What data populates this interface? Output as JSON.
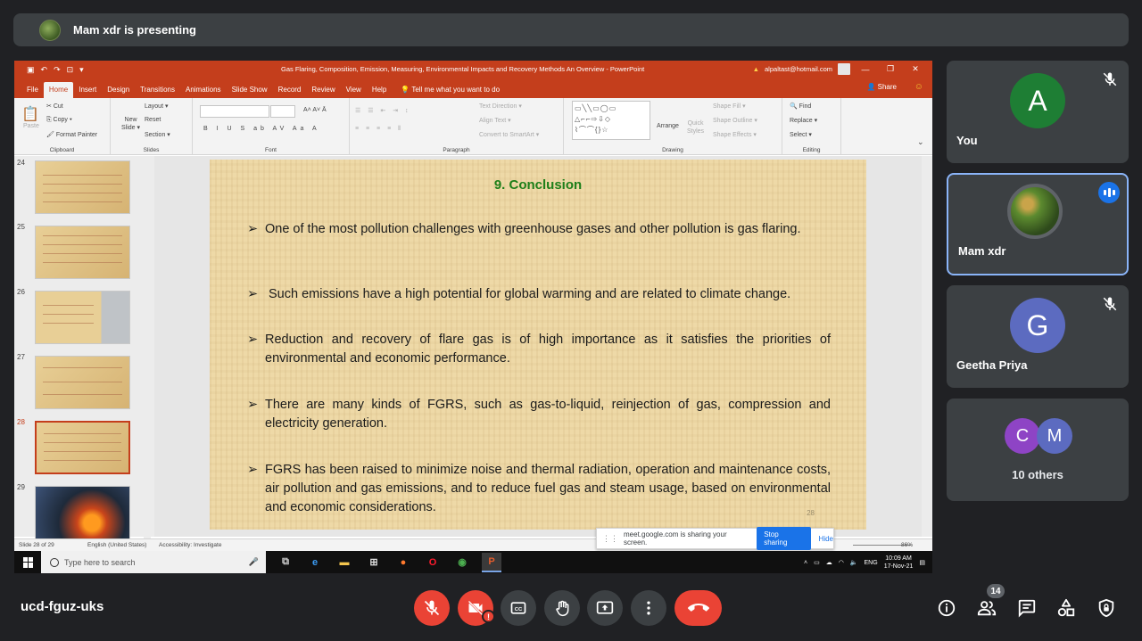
{
  "presenting_bar": {
    "text": "Mam xdr is presenting"
  },
  "ppt": {
    "window_title": "Gas Flaring, Composition, Emission, Measuring, Environmental Impacts and Recovery Methods An Overview  -  PowerPoint",
    "warning_icon": "warning-icon",
    "user_email": "alpaltast@hotmail.com",
    "tabs": [
      "File",
      "Home",
      "Insert",
      "Design",
      "Transitions",
      "Animations",
      "Slide Show",
      "Record",
      "Review",
      "View",
      "Help"
    ],
    "active_tab": "Home",
    "tell_me": "Tell me what you want to do",
    "share_label": "Share",
    "ribbon": {
      "clipboard": {
        "paste": "Paste",
        "cut": "Cut",
        "copy": "Copy",
        "format_painter": "Format Painter",
        "label": "Clipboard"
      },
      "slides": {
        "new_slide_line1": "New",
        "new_slide_line2": "Slide",
        "layout": "Layout",
        "reset": "Reset",
        "section": "Section",
        "label": "Slides"
      },
      "font": {
        "label": "Font"
      },
      "paragraph": {
        "text_direction": "Text Direction",
        "align_text": "Align Text",
        "convert_smartart": "Convert to SmartArt",
        "label": "Paragraph"
      },
      "drawing": {
        "arrange": "Arrange",
        "quick_styles_line1": "Quick",
        "quick_styles_line2": "Styles",
        "shape_fill": "Shape Fill",
        "shape_outline": "Shape Outline",
        "shape_effects": "Shape Effects",
        "label": "Drawing"
      },
      "editing": {
        "find": "Find",
        "replace": "Replace",
        "select": "Select",
        "label": "Editing"
      }
    },
    "thumbnails": [
      {
        "num": "24",
        "selected": false
      },
      {
        "num": "25",
        "selected": false
      },
      {
        "num": "26",
        "selected": false
      },
      {
        "num": "27",
        "selected": false
      },
      {
        "num": "28",
        "selected": true
      },
      {
        "num": "29",
        "selected": false
      }
    ],
    "slide": {
      "title": "9.   Conclusion",
      "bullets": [
        "One of the most pollution challenges with greenhouse gases and other pollution is gas flaring.",
        "Such emissions have a high potential for global warming and are related to climate change.",
        "Reduction and recovery of flare gas is of high importance as it satisfies the priorities of environmental and economic performance.",
        "There are many kinds of FGRS, such as gas-to-liquid, reinjection of gas, compression and electricity generation.",
        "FGRS has been raised to minimize noise and thermal radiation, operation and maintenance costs, air pollution and gas emissions, and to reduce fuel gas and steam usage, based on environmental and economic considerations."
      ],
      "page_number": "28"
    },
    "status": {
      "slide_info": "Slide 28 of 29",
      "language": "English (United States)",
      "accessibility": "Accessibility: Investigate",
      "zoom": "86%"
    },
    "share_notice": {
      "text": "meet.google.com is sharing your screen.",
      "stop": "Stop sharing",
      "hide": "Hide"
    },
    "taskbar": {
      "search_placeholder": "Type here to search",
      "lang": "ENG",
      "time": "10:09 AM",
      "date": "17-Nov-21"
    }
  },
  "participants": [
    {
      "name": "You",
      "initial": "A",
      "color": "#1e7e34",
      "muted": true
    },
    {
      "name": "Mam xdr",
      "speaking": true
    },
    {
      "name": "Geetha Priya",
      "initial": "G",
      "color": "#5c6bc0",
      "muted": true
    }
  ],
  "others": {
    "label": "10 others",
    "avatars": [
      {
        "initial": "C",
        "color": "#8e44c5"
      },
      {
        "initial": "M",
        "color": "#5c6bc0"
      }
    ]
  },
  "meeting": {
    "code": "ucd-fguz-uks",
    "participant_count": "14"
  }
}
